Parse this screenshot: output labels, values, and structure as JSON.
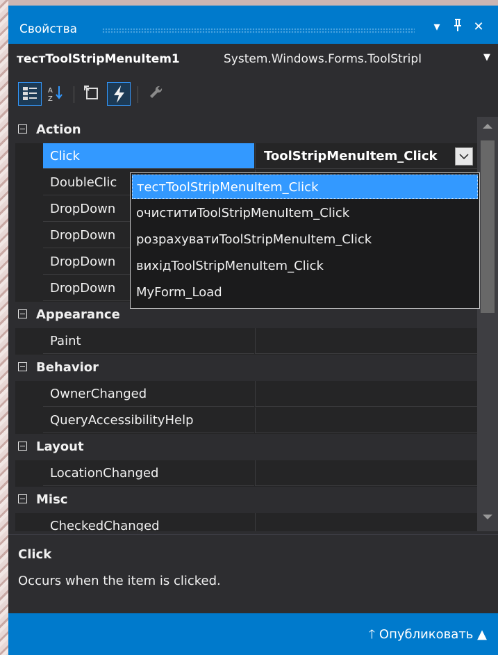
{
  "panel": {
    "title": "Свойства",
    "controls": [
      "▾",
      "ᚹ",
      "✕"
    ]
  },
  "object_selector": {
    "name": "тестToolStripMenuItem1",
    "type": "System.Windows.Forms.ToolStripI"
  },
  "toolbar": {
    "buttons": [
      "categorized-icon",
      "alphabetical-icon",
      "properties-icon",
      "events-icon",
      "property-pages-icon"
    ],
    "active": "events-icon"
  },
  "grid": {
    "categories": [
      {
        "name": "Action",
        "items": [
          "Click",
          "DoubleClic",
          "DropDown",
          "DropDown",
          "DropDown",
          "DropDown"
        ]
      },
      {
        "name": "Appearance",
        "items": [
          "Paint"
        ]
      },
      {
        "name": "Behavior",
        "items": [
          "OwnerChanged",
          "QueryAccessibilityHelp"
        ]
      },
      {
        "name": "Layout",
        "items": [
          "LocationChanged"
        ]
      },
      {
        "name": "Misc",
        "items": [
          "CheckedChanged"
        ]
      }
    ],
    "selected_property": "Click",
    "selected_value": "ToolStripMenuItem_Click"
  },
  "dropdown": {
    "options": [
      "тестToolStripMenuItem_Click",
      "очиститиToolStripMenuItem_Click",
      "розрахуватиToolStripMenuItem_Click",
      "вихідToolStripMenuItem_Click",
      "MyForm_Load"
    ],
    "highlighted_index": 0
  },
  "description": {
    "title": "Click",
    "text": "Occurs when the item is clicked."
  },
  "statusbar": {
    "publish_label": "Опубликовать"
  },
  "colors": {
    "accent": "#007acc",
    "selection": "#3399ff",
    "background": "#2d2d30",
    "grid_background": "#252526"
  }
}
